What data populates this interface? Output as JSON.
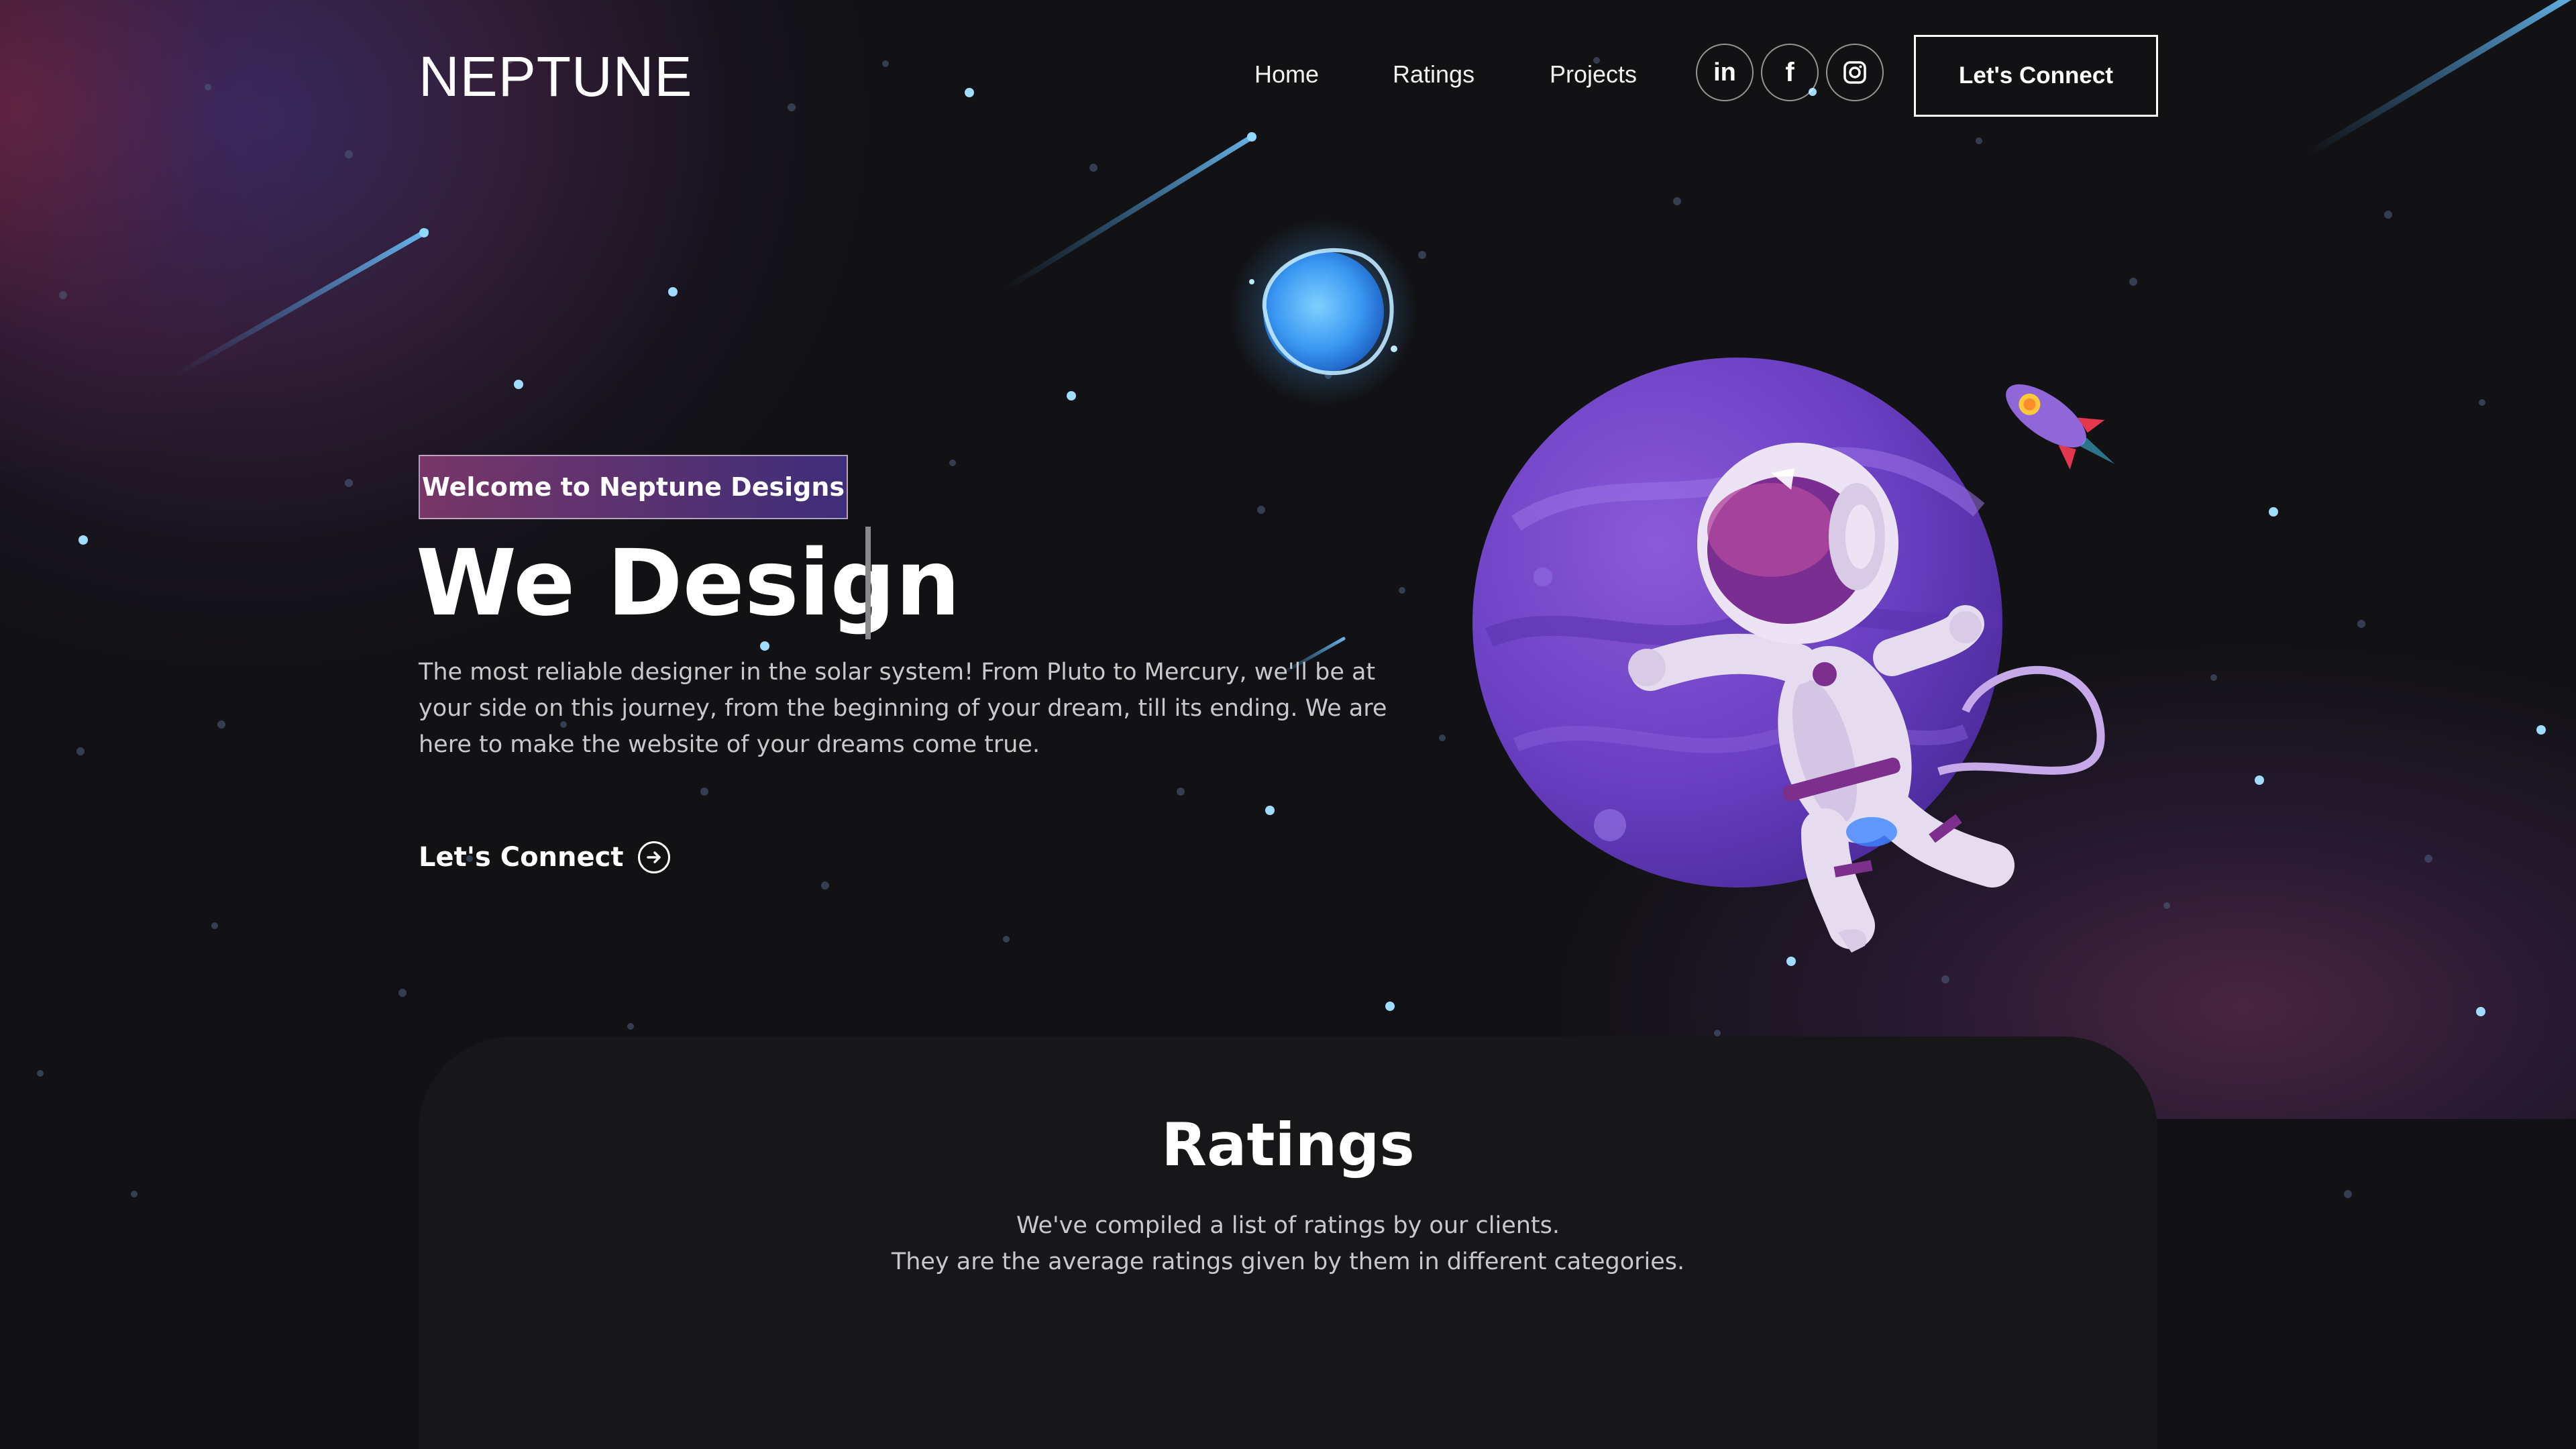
{
  "header": {
    "logo": "NEPTUNE",
    "nav": [
      {
        "label": "Home"
      },
      {
        "label": "Ratings"
      },
      {
        "label": "Projects"
      }
    ],
    "social": [
      {
        "icon": "linkedin-icon",
        "glyph": "in"
      },
      {
        "icon": "facebook-icon",
        "glyph": "f"
      },
      {
        "icon": "instagram-icon",
        "glyph": ""
      }
    ],
    "cta_label": "Let's Connect"
  },
  "hero": {
    "tagline": "Welcome to Neptune Designs",
    "headline": "We Design",
    "description": "The most reliable designer in the solar system! From Pluto to Mercury, we'll be at your side on this journey, from the beginning of your dream, till its ending. We are here to make the website of your dreams come true.",
    "link_label": "Let's Connect"
  },
  "ratings": {
    "title": "Ratings",
    "subtitle_line1": "We've compiled a list of ratings by our clients.",
    "subtitle_line2": "They are the average ratings given by them in different categories."
  },
  "colors": {
    "background": "#121214",
    "accent_purple": "#6f3fc8",
    "accent_magenta": "#a9368f",
    "planet_blue": "#4aa8ff"
  }
}
